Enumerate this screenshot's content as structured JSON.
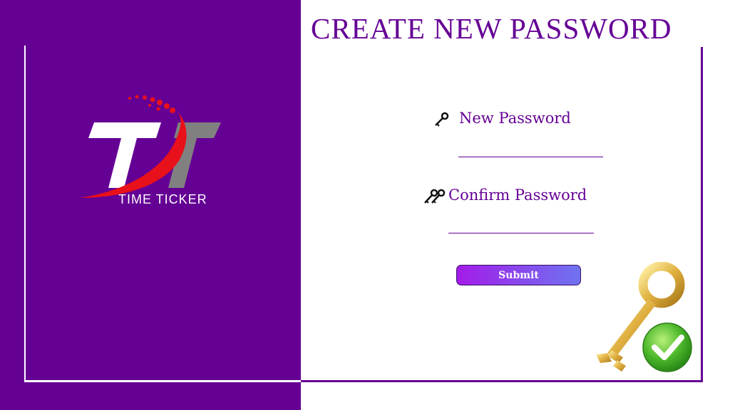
{
  "title": "CREATE NEW PASSWORD",
  "brand": {
    "logo_text": "TIME TICKER",
    "logo_letters": "TT"
  },
  "form": {
    "new_password_label": "New Password",
    "new_password_value": "",
    "confirm_password_label": "Confirm Password",
    "confirm_password_value": "",
    "submit_label": "Submit"
  },
  "icons": [
    "key-icon",
    "keys-icon",
    "golden-key-check-icon"
  ],
  "colors": {
    "brand_purple": "#650095",
    "button_gradient_start": "#a31ce8",
    "button_gradient_end": "#6f73f0",
    "logo_red": "#e8101a",
    "logo_gray": "#808080"
  }
}
